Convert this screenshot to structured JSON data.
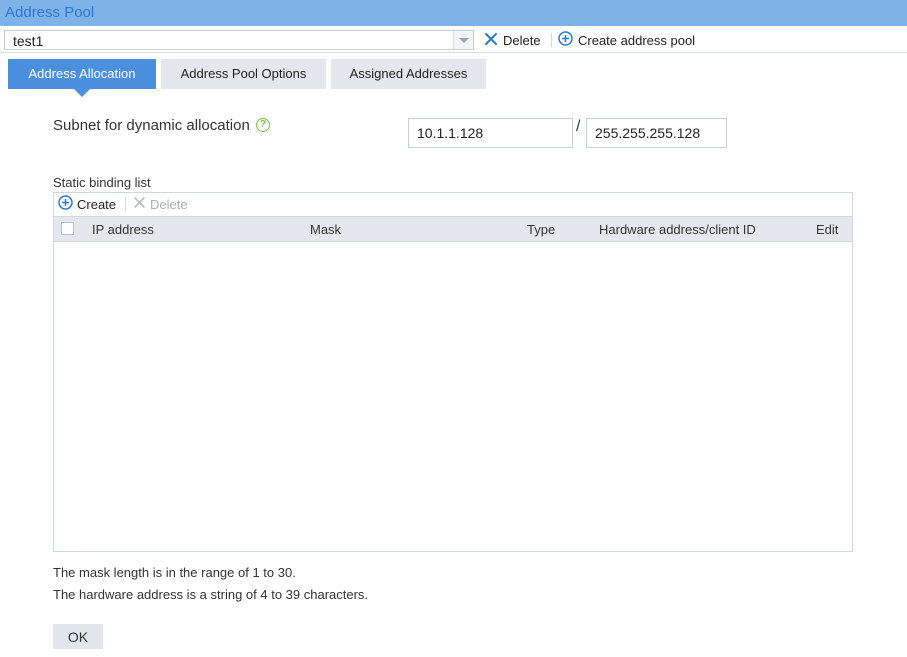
{
  "title": "Address Pool",
  "toolbar": {
    "pool_value": "test1",
    "delete_label": "Delete",
    "create_label": "Create address pool"
  },
  "tabs": [
    {
      "label": "Address Allocation",
      "active": true
    },
    {
      "label": "Address Pool Options",
      "active": false
    },
    {
      "label": "Assigned Addresses",
      "active": false
    }
  ],
  "subnet": {
    "label": "Subnet for dynamic allocation",
    "ip": "10.1.1.128",
    "separator": "/",
    "mask": "255.255.255.128"
  },
  "static_list": {
    "label": "Static binding list",
    "create_label": "Create",
    "delete_label": "Delete",
    "columns": [
      "IP address",
      "Mask",
      "Type",
      "Hardware address/client ID",
      "Edit"
    ],
    "rows": []
  },
  "notes": [
    "The mask length is in the range of 1 to 30.",
    "The hardware address is a string of 4 to 39 characters."
  ],
  "ok_label": "OK",
  "colors": {
    "titlebar": "#7fb3e8",
    "accent": "#4a90de",
    "help": "#7cc240"
  }
}
